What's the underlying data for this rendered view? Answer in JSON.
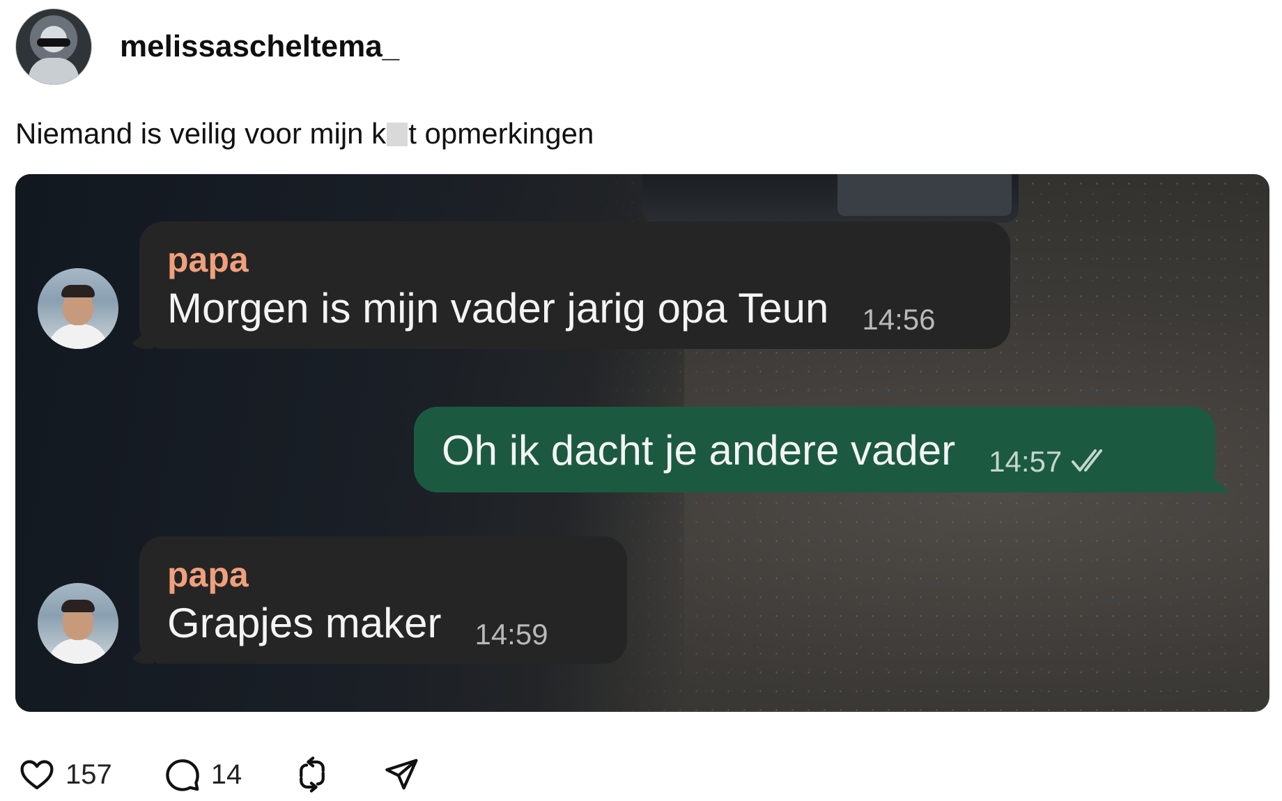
{
  "post": {
    "username": "melissascheltema_",
    "caption_before": "Niemand is veilig voor mijn k",
    "caption_after": "t opmerkingen"
  },
  "chat": {
    "messages": [
      {
        "sender": "papa",
        "text": "Morgen is mijn vader jarig opa Teun",
        "time": "14:56"
      },
      {
        "text": "Oh ik dacht je andere vader",
        "time": "14:57"
      },
      {
        "sender": "papa",
        "text": "Grapjes maker",
        "time": "14:59"
      }
    ]
  },
  "actions": {
    "likes": "157",
    "comments": "14"
  },
  "icons": {
    "like": "heart-icon",
    "comment": "comment-icon",
    "repost": "repost-icon",
    "share": "share-icon",
    "read": "double-check-icon"
  },
  "colors": {
    "sender_name": "#f0a07c",
    "outgoing_bubble": "#1b5a41",
    "incoming_bubble": "#252525"
  }
}
